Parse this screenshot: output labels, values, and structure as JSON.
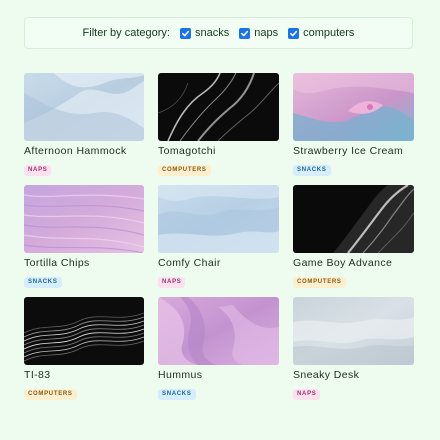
{
  "filter": {
    "label": "Filter by category:",
    "options": [
      {
        "label": "snacks",
        "checked": true
      },
      {
        "label": "naps",
        "checked": true
      },
      {
        "label": "computers",
        "checked": true
      }
    ]
  },
  "items": [
    {
      "title": "Afternoon Hammock",
      "tag": "NAPS",
      "category": "naps",
      "image": "pale-blue-fabric-folds"
    },
    {
      "title": "Tomagotchi",
      "tag": "COMPUTERS",
      "category": "computers",
      "image": "dark-silk-waves"
    },
    {
      "title": "Strawberry Ice Cream",
      "tag": "SNACKS",
      "category": "snacks",
      "image": "pink-blue-swirl"
    },
    {
      "title": "Tortilla Chips",
      "tag": "SNACKS",
      "category": "snacks",
      "image": "lavender-ridges"
    },
    {
      "title": "Comfy Chair",
      "tag": "NAPS",
      "category": "naps",
      "image": "light-blue-drape"
    },
    {
      "title": "Game Boy Advance",
      "tag": "COMPUTERS",
      "category": "computers",
      "image": "black-silver-wave"
    },
    {
      "title": "TI-83",
      "tag": "COMPUTERS",
      "category": "computers",
      "image": "dark-contour-lines"
    },
    {
      "title": "Hummus",
      "tag": "SNACKS",
      "category": "snacks",
      "image": "purple-petal-folds"
    },
    {
      "title": "Sneaky Desk",
      "tag": "NAPS",
      "category": "naps",
      "image": "grey-satin-ripple"
    }
  ],
  "colors": {
    "checkbox": "#1a73e8",
    "naps_badge": "#fbe0ee",
    "snacks_badge": "#d6eefc",
    "computers_badge": "#fcefd0"
  }
}
